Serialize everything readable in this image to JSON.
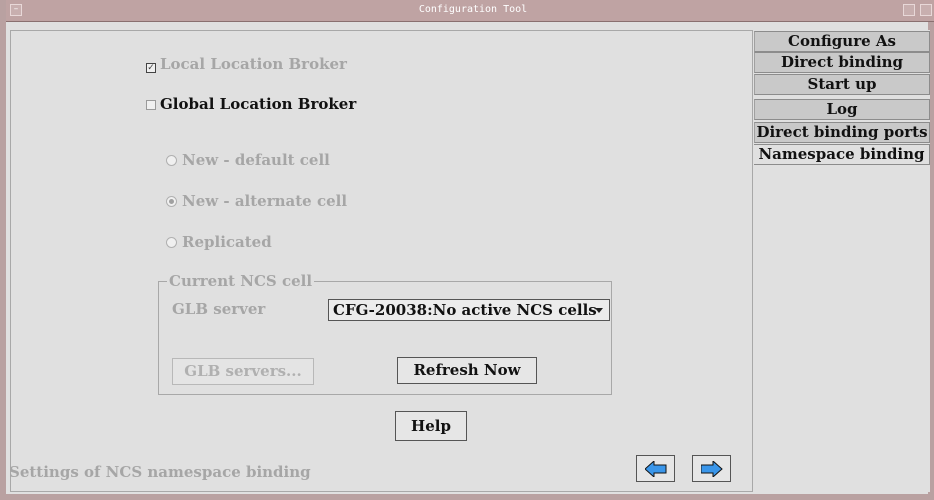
{
  "window": {
    "title": "Configuration Tool"
  },
  "options": {
    "local_location_broker": {
      "label": "Local Location Broker",
      "checked": true,
      "enabled": false
    },
    "global_location_broker": {
      "label": "Global Location Broker",
      "checked": false,
      "enabled": true
    }
  },
  "cell_mode": {
    "items": [
      {
        "label": "New - default cell",
        "selected": false
      },
      {
        "label": "New - alternate cell",
        "selected": true
      },
      {
        "label": "Replicated",
        "selected": false
      }
    ]
  },
  "ncs_cell": {
    "legend": "Current NCS cell",
    "glb_server_label": "GLB server",
    "glb_server_value": "CFG-20038:No active NCS cells",
    "glb_servers_button": "GLB servers...",
    "refresh_button": "Refresh Now"
  },
  "help_button": "Help",
  "status_text": "Settings of NCS namespace binding",
  "navigation": {
    "back_icon": "arrow-left-icon",
    "forward_icon": "arrow-right-icon",
    "arrow_color": "#3a96ea"
  },
  "tabs": [
    {
      "label": "Configure As",
      "active": false
    },
    {
      "label": "Direct binding",
      "active": false
    },
    {
      "label": "Start up",
      "active": false
    },
    {
      "label": "Log",
      "active": false
    },
    {
      "label": "Direct binding ports",
      "active": false
    },
    {
      "label": "Namespace binding",
      "active": true
    }
  ]
}
